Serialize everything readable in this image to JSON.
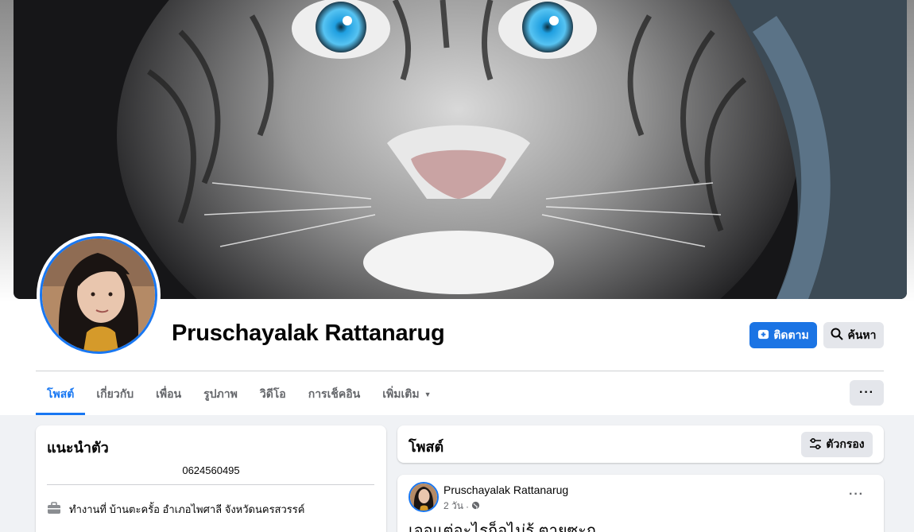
{
  "profile": {
    "name": "Pruschayalak Rattanarug"
  },
  "actions": {
    "follow_label": "ติดตาม",
    "search_label": "ค้นหา",
    "more_label": "···"
  },
  "tabs": [
    {
      "label": "โพสต์",
      "active": true
    },
    {
      "label": "เกี่ยวกับ",
      "active": false
    },
    {
      "label": "เพื่อน",
      "active": false
    },
    {
      "label": "รูปภาพ",
      "active": false
    },
    {
      "label": "วิดีโอ",
      "active": false
    },
    {
      "label": "การเช็คอิน",
      "active": false
    },
    {
      "label": "เพิ่มเติม",
      "active": false
    }
  ],
  "intro": {
    "title": "แนะนำตัว",
    "phone": "0624560495",
    "work": "ทำงานที่ บ้านตะครั้อ อำเภอไพศาลี จังหวัดนครสวรรค์"
  },
  "posts_header": {
    "title": "โพสต์",
    "filter_label": "ตัวกรอง"
  },
  "post": {
    "author": "Pruschayalak Rattanarug",
    "time": "2 วัน",
    "audience_sep": "·",
    "more": "···",
    "text": "เจอแต่อะไรก็อไม่รู้ ตายซะก"
  },
  "colors": {
    "accent": "#1877f2",
    "button_gray": "#e4e6eb",
    "page_bg": "#f0f2f5"
  },
  "icons": {
    "follow": "follow-plus-icon",
    "search": "magnifier-icon",
    "filter": "sliders-icon",
    "work": "briefcase-icon",
    "audience": "globe-icon"
  }
}
